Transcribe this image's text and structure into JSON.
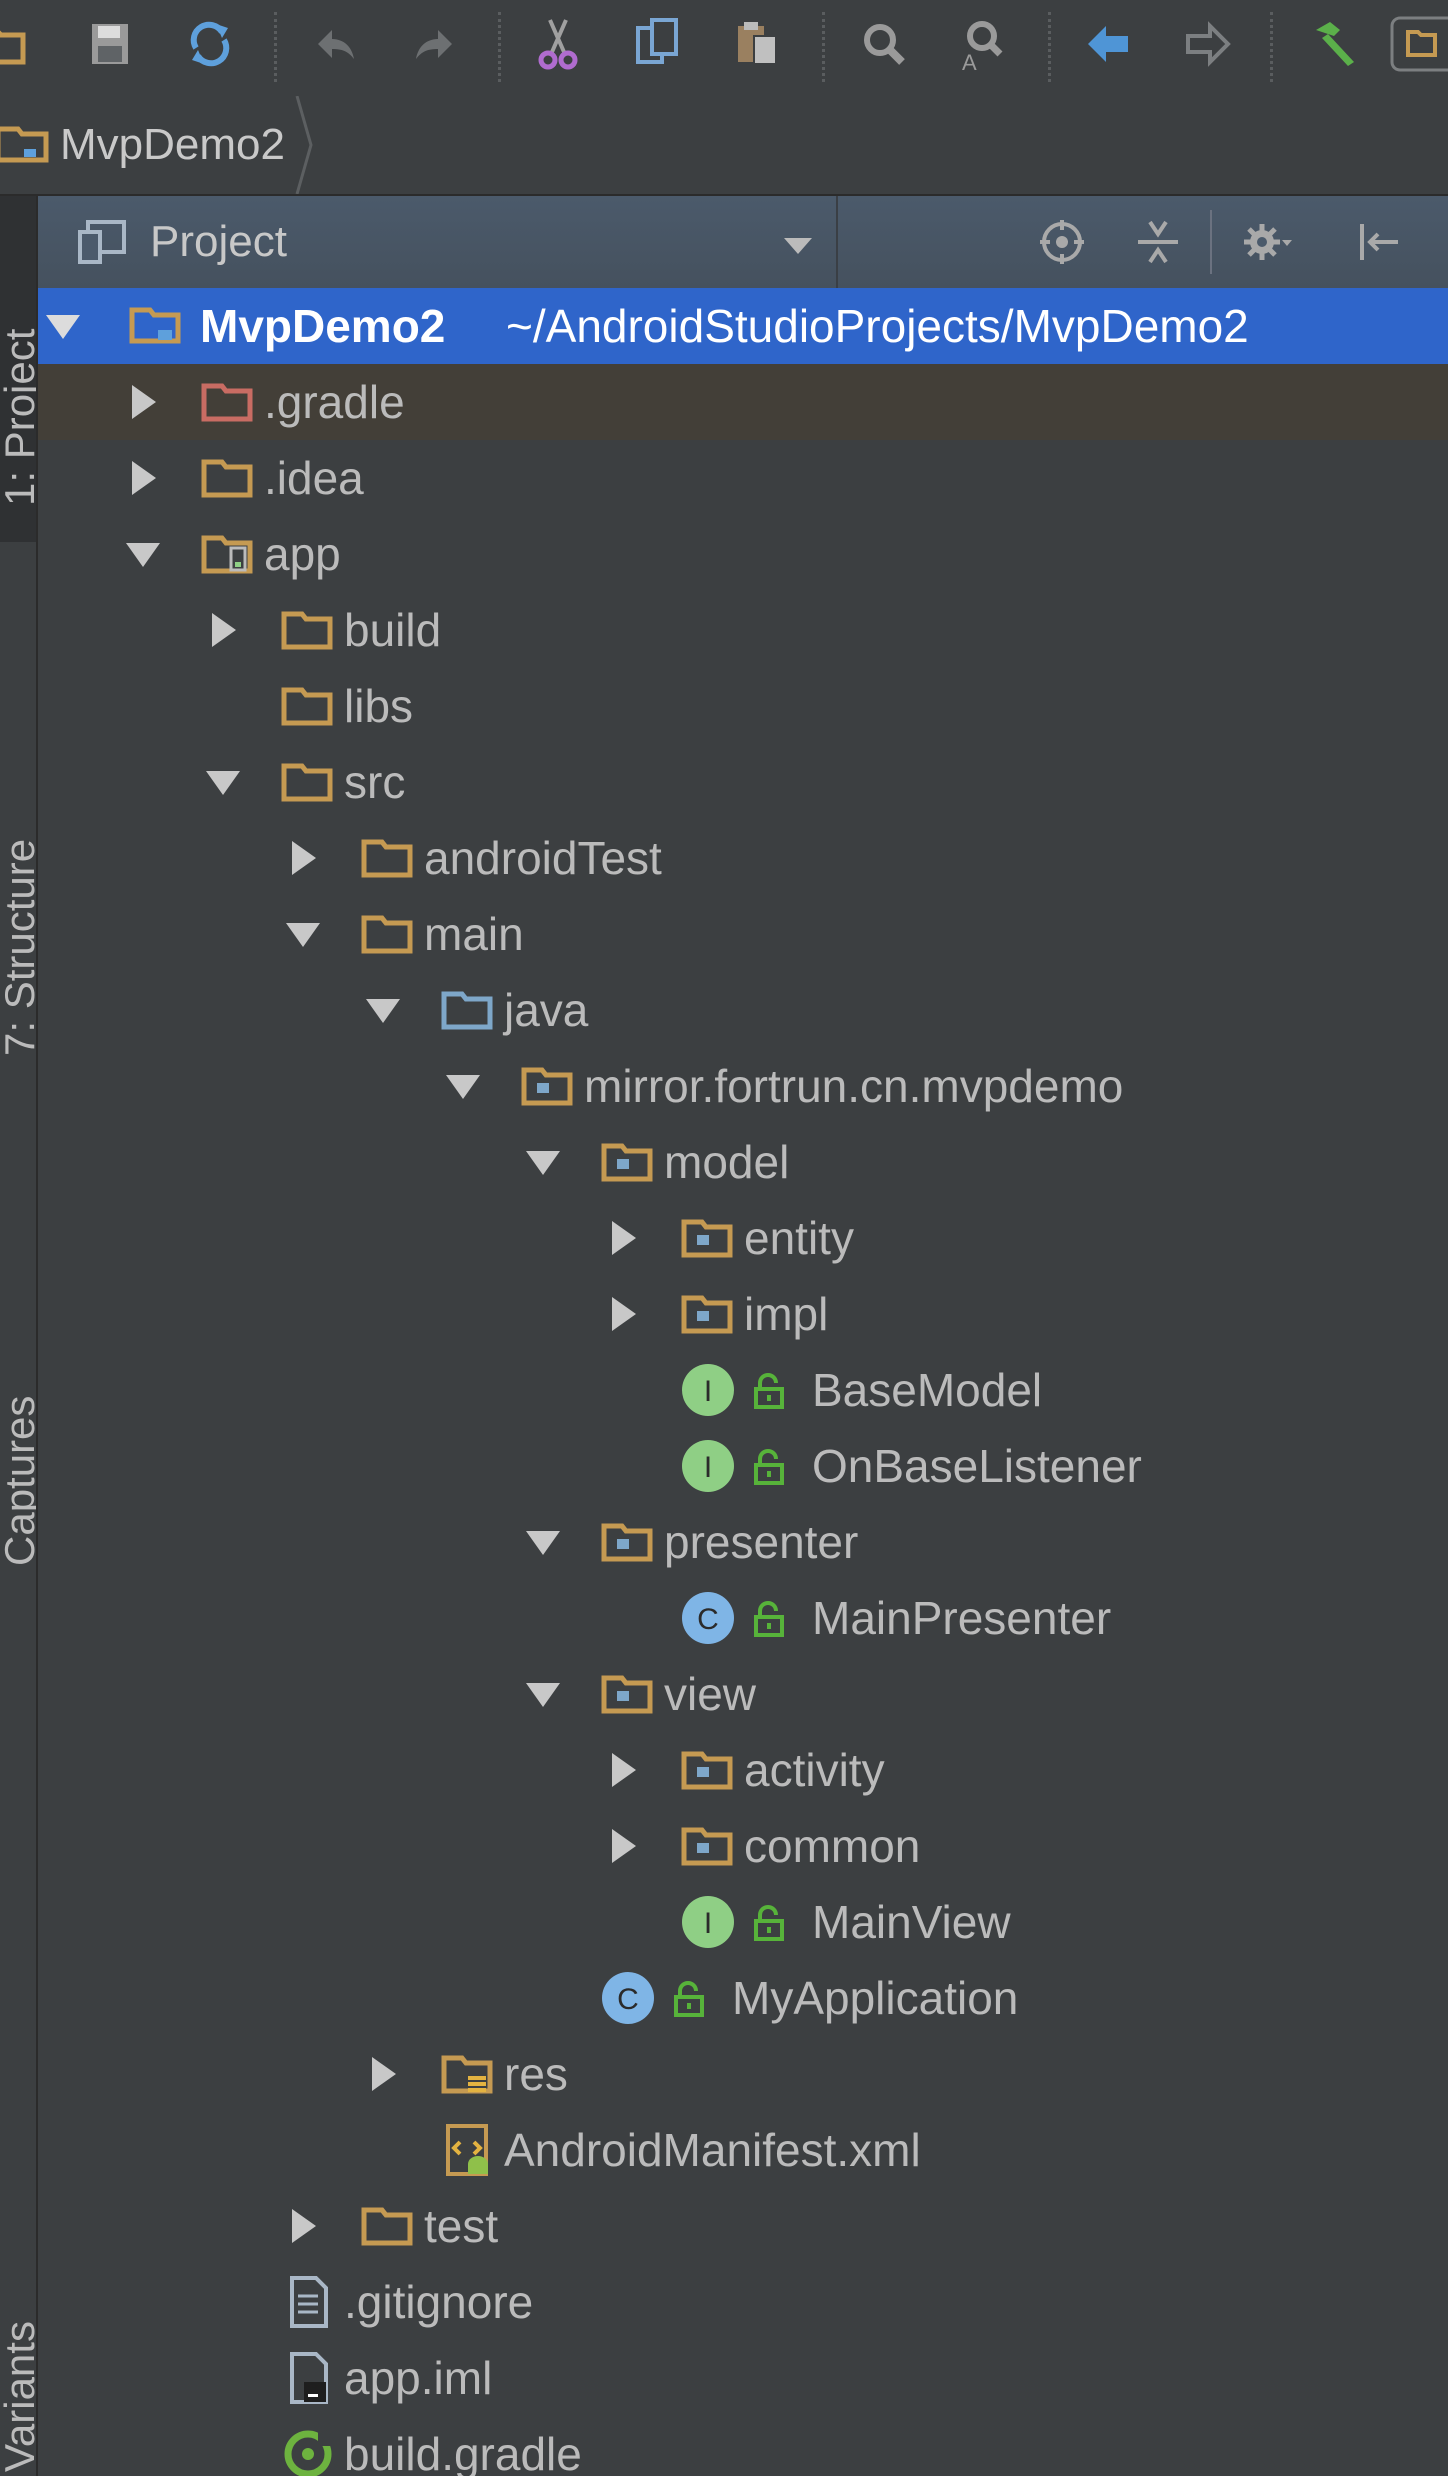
{
  "toolbar": {
    "icons": [
      "folder-icon",
      "save-icon",
      "sync-icon",
      "undo-icon",
      "redo-icon",
      "cut-icon",
      "copy-icon",
      "paste-icon",
      "find-icon",
      "replace-icon",
      "back-icon",
      "forward-icon",
      "build-hammer-icon",
      "run-config-icon"
    ]
  },
  "breadcrumb": {
    "project": "MvpDemo2"
  },
  "side_tabs": [
    "1: Project",
    "7: Structure",
    "Captures",
    "Variants"
  ],
  "panel": {
    "title": "Project",
    "buttons": [
      "locate-icon",
      "collapse-all-icon",
      "settings-gear-icon",
      "hide-panel-icon"
    ]
  },
  "tree": {
    "root": {
      "name": "MvpDemo2",
      "path": "~/AndroidStudioProjects/MvpDemo2"
    },
    "items": [
      {
        "label": ".gradle",
        "state": "collapsed"
      },
      {
        "label": ".idea",
        "state": "collapsed"
      },
      {
        "label": "app",
        "state": "expanded"
      },
      {
        "label": "build",
        "state": "collapsed"
      },
      {
        "label": "libs",
        "state": "leaf"
      },
      {
        "label": "src",
        "state": "expanded"
      },
      {
        "label": "androidTest",
        "state": "collapsed"
      },
      {
        "label": "main",
        "state": "expanded"
      },
      {
        "label": "java",
        "state": "expanded"
      },
      {
        "label": "mirror.fortrun.cn.mvpdemo",
        "state": "expanded"
      },
      {
        "label": "model",
        "state": "expanded"
      },
      {
        "label": "entity",
        "state": "collapsed"
      },
      {
        "label": "impl",
        "state": "collapsed"
      },
      {
        "label": "BaseModel",
        "kind": "interface"
      },
      {
        "label": "OnBaseListener",
        "kind": "interface"
      },
      {
        "label": "presenter",
        "state": "expanded"
      },
      {
        "label": "MainPresenter",
        "kind": "class"
      },
      {
        "label": "view",
        "state": "expanded"
      },
      {
        "label": "activity",
        "state": "collapsed"
      },
      {
        "label": "common",
        "state": "collapsed"
      },
      {
        "label": "MainView",
        "kind": "interface"
      },
      {
        "label": "MyApplication",
        "kind": "class"
      },
      {
        "label": "res",
        "state": "collapsed"
      },
      {
        "label": "AndroidManifest.xml",
        "kind": "manifest"
      },
      {
        "label": "test",
        "state": "collapsed"
      },
      {
        "label": ".gitignore",
        "kind": "text-file"
      },
      {
        "label": "app.iml",
        "kind": "iml-file"
      },
      {
        "label": "build.gradle",
        "kind": "gradle-file"
      }
    ]
  },
  "colors": {
    "background": "#3c3f41",
    "selection": "#2f65ca",
    "folder": "#c59a52",
    "excluded_folder": "#c96c63",
    "source_folder": "#7ea7c9",
    "interface_badge": "#8fcf85",
    "class_badge": "#7fb5e6"
  }
}
